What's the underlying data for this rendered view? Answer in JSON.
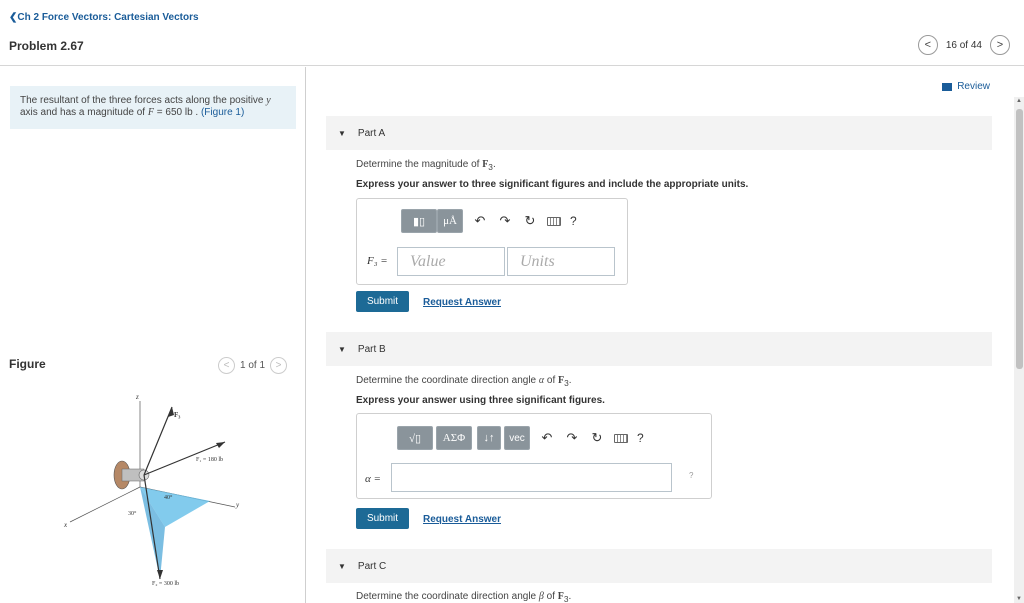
{
  "header": {
    "back_link": "❮Ch 2 Force Vectors: Cartesian Vectors",
    "problem_title": "Problem 2.67",
    "pager_text": "16 of 44",
    "prev_icon": "<",
    "next_icon": ">"
  },
  "problem": {
    "text_part1": "The resultant of the three forces acts along the positive ",
    "axis_var": "y",
    "text_part2": " axis and has a magnitude of ",
    "force_var": "F",
    "text_part3": " = 650  lb . ",
    "figure_link": "(Figure 1)"
  },
  "figure": {
    "label": "Figure",
    "pager_text": "1 of 1",
    "labels": {
      "z": "z",
      "x": "x",
      "y": "y",
      "F3": "F₃",
      "F1": "F₁ = 180 lb",
      "F2": "F₂ = 300 lb",
      "angle40": "40°",
      "angle30": "30°"
    }
  },
  "review": {
    "label": "Review"
  },
  "partA": {
    "title": "Part A",
    "question_pre": "Determine the magnitude of ",
    "question_sym": "F",
    "question_sub": "3",
    "question_post": ".",
    "instructions": "Express your answer to three significant figures and include the appropriate units.",
    "toolbar": {
      "units_btn": "μÅ",
      "undo": "↶",
      "redo": "↷",
      "reset": "↻",
      "help": "?"
    },
    "var_label": "F₃ =",
    "value_placeholder": "Value",
    "units_placeholder": "Units",
    "submit": "Submit",
    "request": "Request Answer"
  },
  "partB": {
    "title": "Part B",
    "question_pre": "Determine the coordinate direction angle ",
    "question_var": "α",
    "question_mid": " of ",
    "question_sym": "F",
    "question_sub": "3",
    "question_post": ".",
    "instructions": "Express your answer using three significant figures.",
    "toolbar": {
      "sqrt_btn": "√▯",
      "greek_btn": "ΑΣΦ",
      "sort_btn": "↓↑",
      "vec_btn": "vec",
      "undo": "↶",
      "redo": "↷",
      "reset": "↻",
      "help": "?"
    },
    "var_label": "α =",
    "side_mark": "?",
    "submit": "Submit",
    "request": "Request Answer"
  },
  "partC": {
    "title": "Part C",
    "question_pre": "Determine the coordinate direction angle ",
    "question_var": "β",
    "question_mid": " of ",
    "question_sym": "F",
    "question_sub": "3",
    "question_post": "."
  },
  "colors": {
    "link": "#1a5c99",
    "submit": "#1d6a96",
    "problem_bg": "#e8f2f7",
    "part_header_bg": "#f3f3f3"
  }
}
